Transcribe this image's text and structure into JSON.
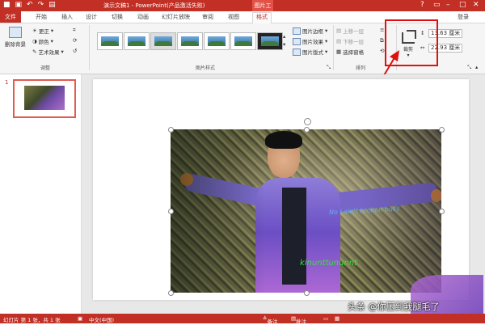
{
  "title_bar": {
    "title": "演示文稿1 - PowerPoint(产品激活失败)",
    "contextual_header": "图片工具",
    "qat_icons": [
      "powerpoint-icon",
      "save-icon",
      "undo-icon",
      "redo-icon",
      "start-icon"
    ],
    "window_controls": [
      "help-icon",
      "restore-ribbon-icon",
      "minimize-icon",
      "maximize-icon",
      "close-icon"
    ]
  },
  "tabs": [
    "文件",
    "开始",
    "插入",
    "设计",
    "切换",
    "动画",
    "幻灯片放映",
    "审阅",
    "视图",
    "格式"
  ],
  "login": "登录",
  "ribbon": {
    "adjust": {
      "remove_bg": "删除背景",
      "corrections": "更正",
      "color": "颜色",
      "artistic": "艺术效果",
      "label": "调整"
    },
    "styles": {
      "label": "图片样式",
      "border": "图片边框",
      "effects": "图片效果",
      "layout": "图片版式"
    },
    "arrange": {
      "label": "排列",
      "bring_forward": "上移一层",
      "send_backward": "下移一层",
      "selection_pane": "选择窗格"
    },
    "size": {
      "crop": "裁剪",
      "height": "13.63 厘米",
      "width": "22.93 厘米"
    }
  },
  "slide_panel": {
    "slide_number": "1"
  },
  "picture_overlay": {
    "blue_text": "No I ain't broken but I",
    "green_text": "kinunttununnt"
  },
  "status_bar": {
    "slide_info": "幻灯片 第 1 张，共 1 张",
    "language": "中文(中国)",
    "notes": "备注",
    "comments": "批注"
  },
  "watermark": "头条 @你压到我腿毛了",
  "colors": {
    "accent": "#c22f25",
    "highlight_box": "#e01010"
  }
}
